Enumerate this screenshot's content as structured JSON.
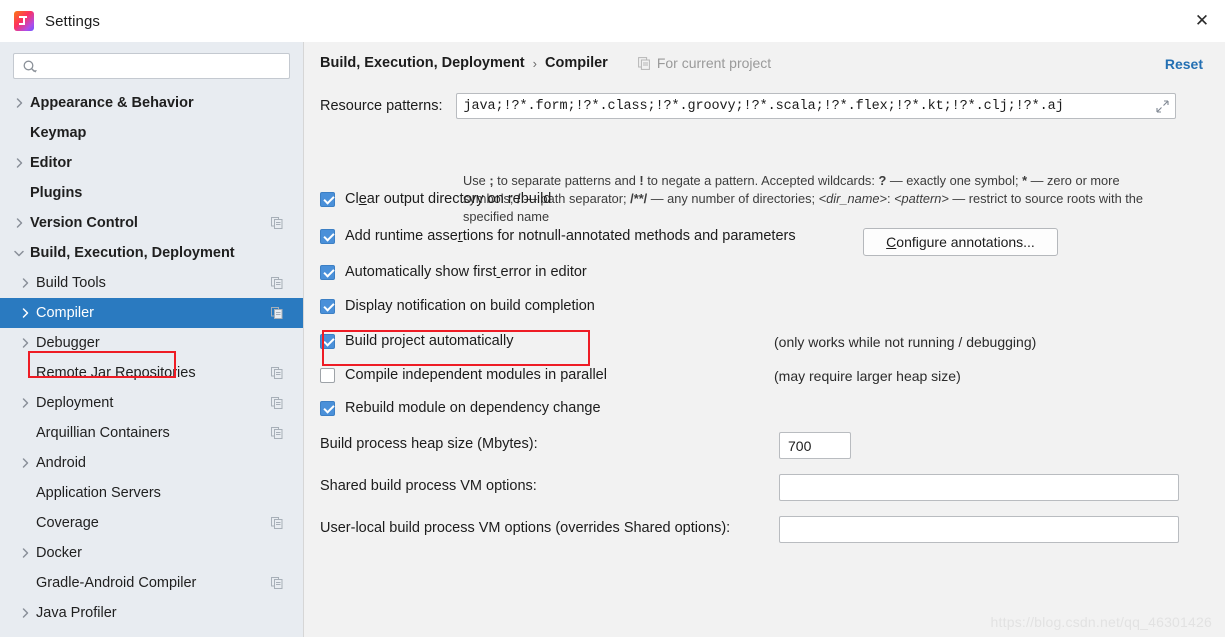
{
  "window": {
    "title": "Settings",
    "app_icon": "intellij-idea-icon",
    "close_label": "✕"
  },
  "sidebar": {
    "search": {
      "placeholder": "",
      "value": "",
      "icon": "search-icon"
    },
    "items": [
      {
        "label": "Appearance & Behavior",
        "level": 1,
        "bold": true,
        "twisty": "collapsed",
        "copy": false,
        "selected": false
      },
      {
        "label": "Keymap",
        "level": 1,
        "bold": true,
        "twisty": "none",
        "copy": false,
        "selected": false
      },
      {
        "label": "Editor",
        "level": 1,
        "bold": true,
        "twisty": "collapsed",
        "copy": false,
        "selected": false
      },
      {
        "label": "Plugins",
        "level": 1,
        "bold": true,
        "twisty": "none",
        "copy": false,
        "selected": false
      },
      {
        "label": "Version Control",
        "level": 1,
        "bold": true,
        "twisty": "collapsed",
        "copy": true,
        "selected": false
      },
      {
        "label": "Build, Execution, Deployment",
        "level": 1,
        "bold": true,
        "twisty": "expanded",
        "copy": false,
        "selected": false
      },
      {
        "label": "Build Tools",
        "level": 2,
        "bold": false,
        "twisty": "collapsed",
        "copy": true,
        "selected": false
      },
      {
        "label": "Compiler",
        "level": 2,
        "bold": false,
        "twisty": "collapsed",
        "copy": true,
        "selected": true
      },
      {
        "label": "Debugger",
        "level": 2,
        "bold": false,
        "twisty": "collapsed",
        "copy": false,
        "selected": false
      },
      {
        "label": "Remote Jar Repositories",
        "level": 2,
        "bold": false,
        "twisty": "none",
        "copy": true,
        "selected": false
      },
      {
        "label": "Deployment",
        "level": 2,
        "bold": false,
        "twisty": "collapsed",
        "copy": true,
        "selected": false
      },
      {
        "label": "Arquillian Containers",
        "level": 2,
        "bold": false,
        "twisty": "none",
        "copy": true,
        "selected": false
      },
      {
        "label": "Android",
        "level": 2,
        "bold": false,
        "twisty": "collapsed",
        "copy": false,
        "selected": false
      },
      {
        "label": "Application Servers",
        "level": 2,
        "bold": false,
        "twisty": "none",
        "copy": false,
        "selected": false
      },
      {
        "label": "Coverage",
        "level": 2,
        "bold": false,
        "twisty": "none",
        "copy": true,
        "selected": false
      },
      {
        "label": "Docker",
        "level": 2,
        "bold": false,
        "twisty": "collapsed",
        "copy": false,
        "selected": false
      },
      {
        "label": "Gradle-Android Compiler",
        "level": 2,
        "bold": false,
        "twisty": "none",
        "copy": true,
        "selected": false
      },
      {
        "label": "Java Profiler",
        "level": 2,
        "bold": false,
        "twisty": "collapsed",
        "copy": false,
        "selected": false
      }
    ]
  },
  "header": {
    "breadcrumb_parent": "Build, Execution, Deployment",
    "breadcrumb_sep": "›",
    "breadcrumb_current": "Compiler",
    "scope_note": "For current project",
    "scope_icon": "project-scope-icon",
    "reset_label": "Reset"
  },
  "main": {
    "resource_patterns": {
      "label": "Resource patterns:",
      "value": "java;!?*.form;!?*.class;!?*.groovy;!?*.scala;!?*.flex;!?*.kt;!?*.clj;!?*.aj",
      "expand_icon": "expand-field-icon"
    },
    "help": {
      "l1_a": "Use ",
      "l1_b": ";",
      "l1_c": " to separate patterns and ",
      "l1_d": "!",
      "l1_e": " to negate a pattern. Accepted wildcards: ",
      "l1_f": "?",
      "l1_g": " — exactly one symbol; ",
      "l1_h": "*",
      "l1_i": " — zero or more symbols; ",
      "l1_j": "/",
      "l1_k": " — path separator; ",
      "l1_l": "/**/",
      "l1_m": " — any number of directories; ",
      "l1_n": "<dir_name>",
      "l1_o": ": ",
      "l1_p": "<pattern>",
      "l1_q": " — restrict to source roots with the specified name"
    },
    "checkboxes": [
      {
        "label": "Clear output directory on rebuild",
        "checked": true,
        "mnemonic_index": 2,
        "hint": ""
      },
      {
        "label": "Add runtime assertions for notnull-annotated methods and parameters",
        "checked": true,
        "mnemonic_index": 16,
        "hint": ""
      },
      {
        "label": "Automatically show first error in editor",
        "checked": true,
        "mnemonic_index": 24,
        "hint": ""
      },
      {
        "label": "Display notification on build completion",
        "checked": true,
        "mnemonic_index": -1,
        "hint": ""
      },
      {
        "label": "Build project automatically",
        "checked": true,
        "mnemonic_index": -1,
        "hint": "(only works while not running / debugging)"
      },
      {
        "label": "Compile independent modules in parallel",
        "checked": false,
        "mnemonic_index": -1,
        "hint": "(may require larger heap size)"
      },
      {
        "label": "Rebuild module on dependency change",
        "checked": true,
        "mnemonic_index": -1,
        "hint": ""
      }
    ],
    "configure_annotations_button": "Configure annotations...",
    "fields": [
      {
        "label": "Build process heap size (Mbytes):",
        "value": "700",
        "placeholder": ""
      },
      {
        "label": "Shared build process VM options:",
        "value": "",
        "placeholder": ""
      },
      {
        "label": "User-local build process VM options (overrides Shared options):",
        "value": "",
        "placeholder": ""
      }
    ]
  },
  "annotations": {
    "highlight_color": "#ee1c25",
    "compiler_box": "red-box-compiler",
    "build-auto_box": "red-box-build-project-automatically"
  },
  "watermark": "https://blog.csdn.net/qq_46301426"
}
